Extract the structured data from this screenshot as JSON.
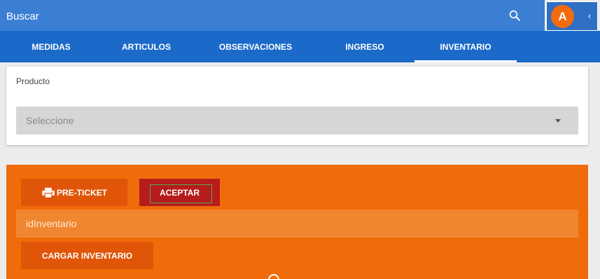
{
  "search": {
    "placeholder": "Buscar"
  },
  "user": {
    "avatar_initial": "A",
    "collapse_glyph": "‹"
  },
  "tabs": [
    {
      "label": "MEDIDAS",
      "active": false
    },
    {
      "label": "ARTICULOS",
      "active": false
    },
    {
      "label": "OBSERVACIONES",
      "active": false
    },
    {
      "label": "INGRESO",
      "active": false
    },
    {
      "label": "INVENTARIO",
      "active": true
    }
  ],
  "product_card": {
    "label": "Producto",
    "select_value": "Seleccione"
  },
  "actions": {
    "preticket_label": "PRE-TICKET",
    "accept_label": "ACEPTAR",
    "inventory_id_placeholder": "idInventario",
    "load_inventory_label": "CARGAR INVENTARIO"
  },
  "icons": {
    "search": "search-icon",
    "printer": "printer-icon",
    "collapse": "chevron-left-icon",
    "dropdown": "caret-down-icon"
  },
  "colors": {
    "search_bar": "#3b7fd4",
    "tab_bar": "#1b6ac9",
    "avatar": "#f46b0e",
    "panel_orange": "#f06c0a",
    "button_orange": "#e05508",
    "accept_red": "#b71c1c"
  }
}
